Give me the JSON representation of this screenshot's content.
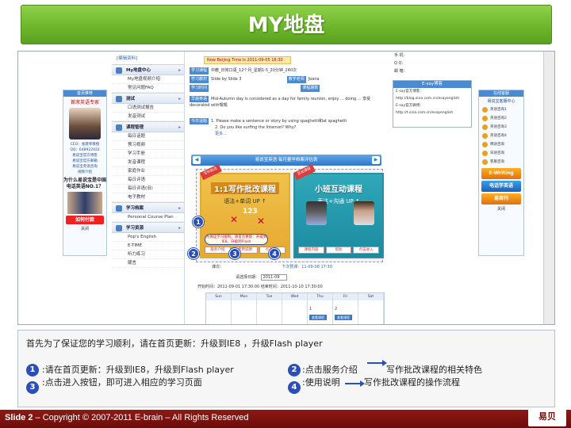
{
  "slide": {
    "title": "MY地盘",
    "footer_slide": "Slide 2",
    "footer_copy": " – Copyright © 2007-2011 E-brain – All Rights Reserved",
    "logo_text": "易贝"
  },
  "left_ad": {
    "head": "首页推荐",
    "sub": "首席英语专家",
    "teacher": "CEO：张建孝教授",
    "qq": "QQ：648922922",
    "line1": "易说宝官方博客",
    "line2": "易说宝官方邮箱",
    "line3": "易说宝英语咨询",
    "line4": "视频介绍",
    "promo": "为什么易说宝是中国电话英语NO.1？",
    "pay": "如何付款",
    "close": "关闭"
  },
  "menu": {
    "edit": "[编辑资料]",
    "sections": [
      {
        "title": "My地盘中心",
        "items": [
          "My地盘视频介绍",
          "常见问题FAQ"
        ]
      },
      {
        "title": "测试",
        "items": [
          "口语测试报告",
          "发音测试"
        ]
      },
      {
        "title": "课程管理",
        "items": [
          "每日话题",
          "预习视频",
          "学习手册",
          "发音课程",
          "家庭作业",
          "每日评语",
          "每日评语(旧)",
          "电子教材"
        ]
      },
      {
        "title": "学习档案",
        "items": [
          "Personal Course Plan"
        ]
      },
      {
        "title": "学习资源",
        "items": [
          "Pop's English",
          "E-TIME",
          "听力练习",
          "箴言"
        ]
      }
    ]
  },
  "main": {
    "beijing_time": "Now Beijing Time Is 2011-09-05 16:30",
    "row1_label": "学习课程",
    "row1_value": "中教_日常口语_12个月_星期1-5_20分钟_240次",
    "row2_label": "学习教材",
    "row2_value": "Slide by Slide 3",
    "row2_label_b": "教学老师",
    "row2_value_b": "Joana",
    "row3_label": "学习时间",
    "row3_label_b": "课程期数",
    "row4_label": "早晨英语",
    "row4_value": "Mid-Autumn day is considered as a day for family reunion, enjoy ... doing ... 享受decorated with嘿嘿",
    "row5_label": "今日话题",
    "row5_line1": "1. Please make a sentence or story by using spaghetti和at spaghetti",
    "row5_line2": "2. Do you like surfing the Internet? Why?",
    "more": "更多...",
    "banner": "易说宝英语  每月量学档案评估表",
    "promo_left_corner": "写作批改",
    "promo_left_title": "1:1写作批改课程",
    "promo_left_sub": "语法+单词 UP ↑",
    "promo_left_num": "123",
    "promo_left_tip": "为保证学习顺利，请首页更新：升级到IE8，升级到Flash",
    "promo_left_btns": [
      "服务介绍",
      "使用说明",
      "点击进入"
    ],
    "promo_right_corner": "互动课程",
    "promo_right_title": "小班互动课程",
    "promo_right_sub": "表达+沟通 UP ↑",
    "promo_right_btns": [
      "课程内容",
      "帮助",
      "点击进入"
    ],
    "under1": "课次：",
    "under1_b": "下次预课：11-09-08 17:30",
    "date_label": "请选择日期：",
    "date_value": "2011-09",
    "start_time": "开始时间：2011-09-01 17:30:00  结束时间：2011-10-10 17:30:00",
    "cal_days": [
      "Sun",
      "Mon",
      "Tue",
      "Wed",
      "Thu",
      "Fri",
      "Sat"
    ],
    "cal_chip1": "查看课程",
    "cal_chip2": "查看课程",
    "cal_d1": "1",
    "cal_d2": "2"
  },
  "right_info": {
    "k1": "手 机：",
    "k2": "Q  Q：",
    "k3": "邮 箱：",
    "esay_head": "E-say博客",
    "esay_l1": "E-say官方博客：",
    "esay_l2": "http://blog.sina.com.cn/esayenglish",
    "esay_l3": "E-say官方微博：",
    "esay_l4": "http://t.sina.com.cn/esayenglish"
  },
  "right_ad": {
    "head": "在线客服",
    "sub": "易说宝客服中心",
    "rows": [
      "英语咨询1",
      "英语咨询2",
      "英语咨询3",
      "英语咨询4",
      "韩语咨询",
      "日语咨询",
      "客服咨询"
    ],
    "btn1": "E-Writing",
    "btn2": "电话学英语",
    "btn3": "易周刊",
    "close": "关闭"
  },
  "desc": {
    "top": "首先为了保证您的学习顺利，请在首页更新：升级到IE8 ，升级Flash player",
    "item1": ":请在首页更新：升级到IE8，升级到Flash player",
    "item2": ":点击服务介绍",
    "item2_b": "写作批改课程的相关特色",
    "item3": ":点击进入按钮，即可进入相应的学习页面",
    "item4": ":使用说明",
    "item4_b": "写作批改课程的操作流程",
    "n1": "1",
    "n2": "2",
    "n3": "3",
    "n4": "4"
  }
}
